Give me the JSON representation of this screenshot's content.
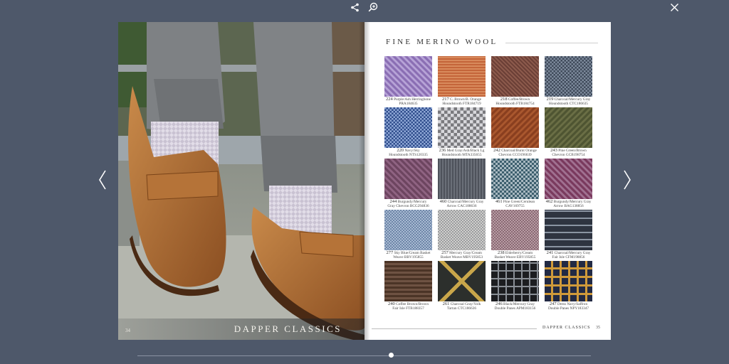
{
  "toolbar": {
    "share_icon": "share-icon",
    "zoom_icon": "zoom-in-icon",
    "close_icon": "close-icon"
  },
  "left_page": {
    "brand": "DAPPER CLASSICS",
    "page_number": "34"
  },
  "right_page": {
    "title": "FINE MERINO WOOL",
    "brand": "DAPPER CLASSICS",
    "page_number": "35",
    "swatches": [
      {
        "num": "224",
        "line1": "Purple/Ash Herringbone",
        "line2": "PRA184635"
      },
      {
        "num": "217",
        "line1": "C. Brown/B. Orange",
        "line2": "Houndstooth FTR184719"
      },
      {
        "num": "218",
        "line1": "Coffee/Brown",
        "line2": "Houndstooth FTB184754"
      },
      {
        "num": "219",
        "line1": "Charcoal/Mercury Gray",
        "line2": "Houndstooth CTC186635"
      },
      {
        "num": "220",
        "line1": "Navy/Sky",
        "line2": "Houndstooth NTS120335"
      },
      {
        "num": "236",
        "line1": "Med Gray/Ash/Black Lg",
        "line2": "Houndstooth MTA335655"
      },
      {
        "num": "242",
        "line1": "Charcoal/Burnt Orange",
        "line2": "Chevron CCO196639"
      },
      {
        "num": "243",
        "line1": "Pine Green/Brown",
        "line2": "Chevron GCB198754"
      },
      {
        "num": "244",
        "line1": "Burgundy/Mercury",
        "line2": "Gray Chevron BCG294836"
      },
      {
        "num": "460",
        "line1": "Charcoal/Mercury Gray",
        "line2": "Arrow CAC188636"
      },
      {
        "num": "461",
        "line1": "Pine Green/Cerulean",
        "line2": "CAV169755"
      },
      {
        "num": "462",
        "line1": "Burgundy/Mercury Gray",
        "line2": "Arrow BAG138856"
      },
      {
        "num": "277",
        "line1": "Sky Blue/Cream Basket",
        "line2": "Weave BBV195855"
      },
      {
        "num": "257",
        "line1": "Mercury Gray/Cream",
        "line2": "Basket Weave MBV195853"
      },
      {
        "num": "238",
        "line1": "Elderberry/Cream",
        "line2": "Basket Weave EBV195855"
      },
      {
        "num": "241",
        "line1": "Charcoal/Mercury Gray",
        "line2": "Fair Isle CFM198856"
      },
      {
        "num": "240",
        "line1": "Coffee Brown/Brown",
        "line2": "Fair Isle FTB188357"
      },
      {
        "num": "261",
        "line1": "Charcoal Gray/Yolk",
        "line2": "Tartan CTC186636"
      },
      {
        "num": "246",
        "line1": "Black/Mercury Gray",
        "line2": "Double Panes APM183156"
      },
      {
        "num": "247",
        "line1": "Dress Navy/Saffron",
        "line2": "Double Panes NPY183347"
      }
    ]
  },
  "navigation": {
    "prev_icon": "chevron-left-icon",
    "next_icon": "chevron-right-icon",
    "progress": 0.56
  }
}
